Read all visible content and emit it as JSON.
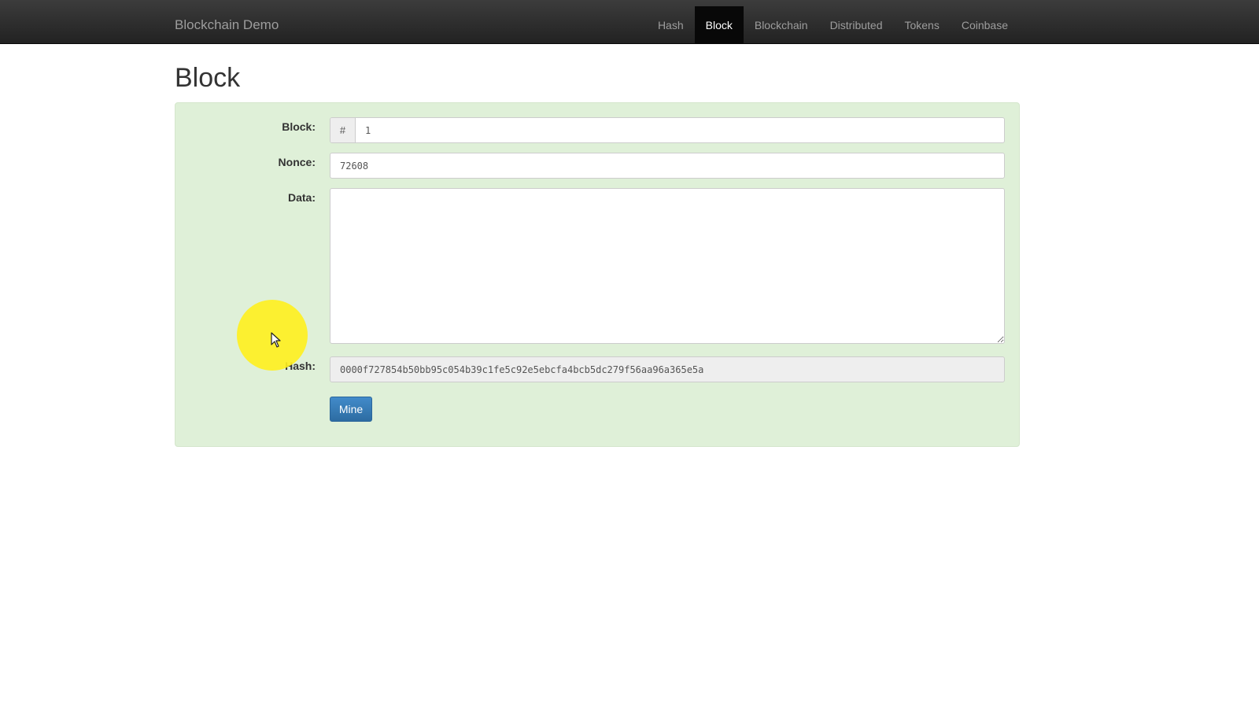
{
  "navbar": {
    "brand": "Blockchain Demo",
    "items": [
      {
        "label": "Hash",
        "active": false
      },
      {
        "label": "Block",
        "active": true
      },
      {
        "label": "Blockchain",
        "active": false
      },
      {
        "label": "Distributed",
        "active": false
      },
      {
        "label": "Tokens",
        "active": false
      },
      {
        "label": "Coinbase",
        "active": false
      }
    ]
  },
  "page": {
    "title": "Block"
  },
  "form": {
    "block_label": "Block:",
    "block_prefix": "#",
    "block_value": "1",
    "nonce_label": "Nonce:",
    "nonce_value": "72608",
    "data_label": "Data:",
    "data_value": "",
    "hash_label": "Hash:",
    "hash_value": "0000f727854b50bb95c054b39c1fe5c92e5ebcfa4bcb5dc279f56aa96a365e5a",
    "mine_label": "Mine"
  },
  "colors": {
    "navbar_bg": "#222222",
    "well_bg": "#dff0d8",
    "primary_button": "#428bca",
    "cursor_highlight": "#fff01e"
  }
}
